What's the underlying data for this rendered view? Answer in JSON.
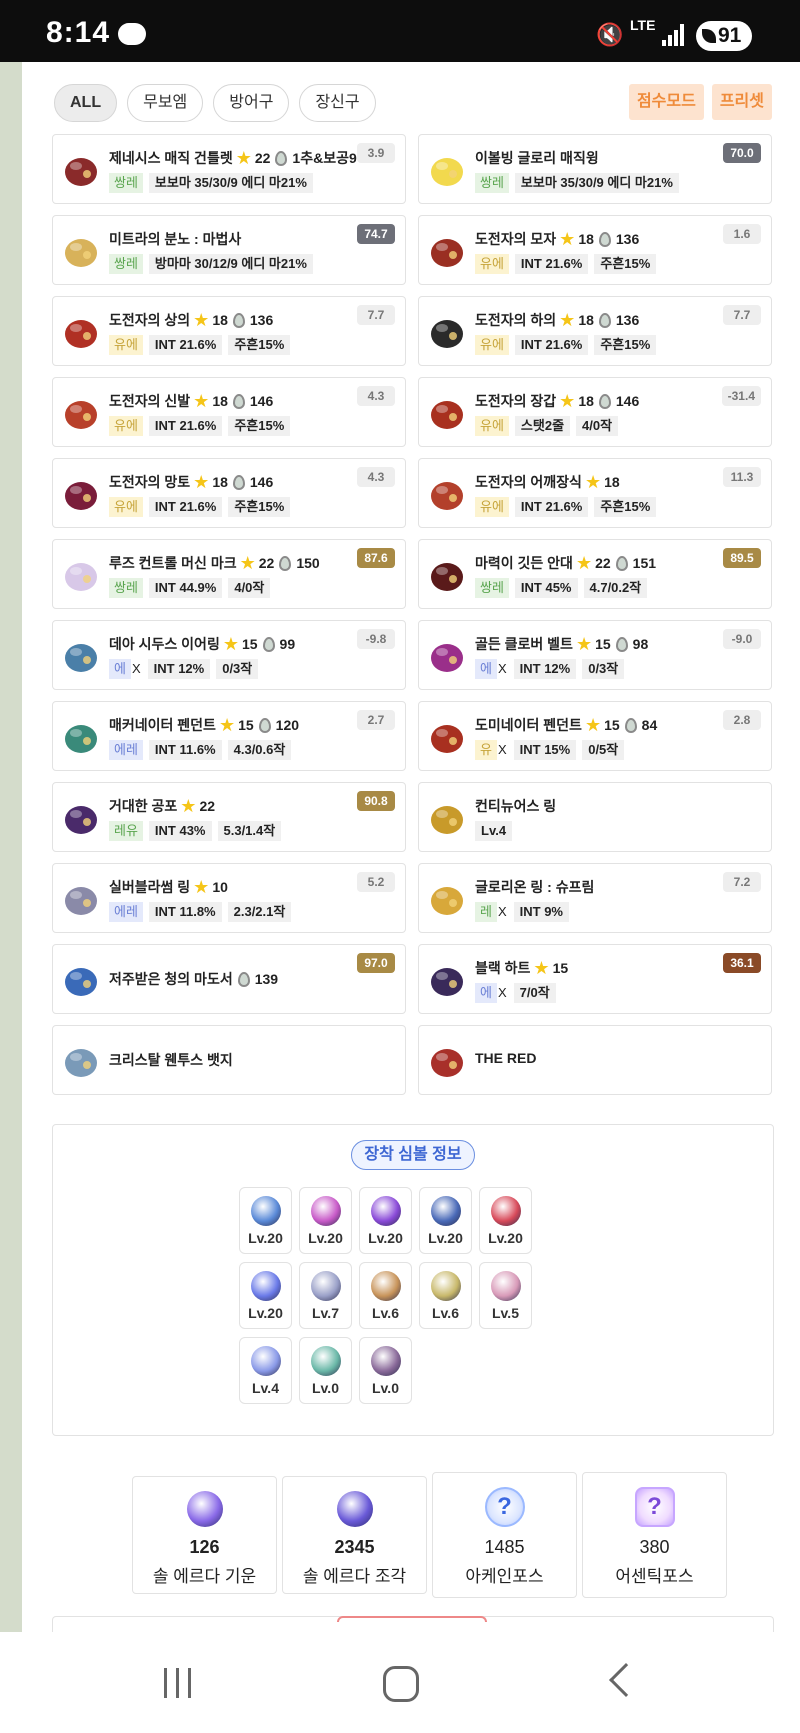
{
  "status_bar": {
    "time": "8:14",
    "network": "LTE",
    "battery": "91"
  },
  "filters": [
    "ALL",
    "무보엠",
    "방어구",
    "장신구"
  ],
  "modes": [
    "점수모드",
    "프리셋"
  ],
  "items": [
    {
      "name": "제네시스 매직 건틀렛",
      "star": "22",
      "drop": "1추&보공9",
      "tags": [
        {
          "t": "쌍레",
          "c": "green"
        },
        {
          "t": "보보마 35/30/9 에디 마21%",
          "c": "plain"
        }
      ],
      "score": "3.9",
      "score_style": "light",
      "icon": "gauntlet-icon",
      "color": "#8a2a2a"
    },
    {
      "name": "이볼빙 글로리 매직윙",
      "tags": [
        {
          "t": "쌍레",
          "c": "green"
        },
        {
          "t": "보보마 35/30/9 에디 마21%",
          "c": "plain"
        }
      ],
      "score": "70.0",
      "score_style": "gray",
      "icon": "wing-icon",
      "color": "#f2d94e"
    },
    {
      "name": "미트라의 분노 : 마법사",
      "tags": [
        {
          "t": "쌍레",
          "c": "green"
        },
        {
          "t": "방마마 30/12/9 에디 마21%",
          "c": "plain"
        }
      ],
      "score": "74.7",
      "score_style": "gray",
      "icon": "emblem-icon",
      "color": "#d8b25a"
    },
    {
      "name": "도전자의 모자",
      "star": "18",
      "drop": "136",
      "tags": [
        {
          "t": "유에",
          "c": "yellow"
        },
        {
          "t": "INT 21.6%",
          "c": "plain"
        },
        {
          "t": "주흔15%",
          "c": "plain"
        }
      ],
      "score": "1.6",
      "score_style": "light",
      "icon": "hat-icon",
      "color": "#9a2f22"
    },
    {
      "name": "도전자의 상의",
      "star": "18",
      "drop": "136",
      "tags": [
        {
          "t": "유에",
          "c": "yellow"
        },
        {
          "t": "INT 21.6%",
          "c": "plain"
        },
        {
          "t": "주흔15%",
          "c": "plain"
        }
      ],
      "score": "7.7",
      "score_style": "light",
      "icon": "top-icon",
      "color": "#b03024"
    },
    {
      "name": "도전자의 하의",
      "star": "18",
      "drop": "136",
      "tags": [
        {
          "t": "유에",
          "c": "yellow"
        },
        {
          "t": "INT 21.6%",
          "c": "plain"
        },
        {
          "t": "주흔15%",
          "c": "plain"
        }
      ],
      "score": "7.7",
      "score_style": "light",
      "icon": "pants-icon",
      "color": "#2a2a2a"
    },
    {
      "name": "도전자의 신발",
      "star": "18",
      "drop": "146",
      "tags": [
        {
          "t": "유에",
          "c": "yellow"
        },
        {
          "t": "INT 21.6%",
          "c": "plain"
        },
        {
          "t": "주흔15%",
          "c": "plain"
        }
      ],
      "score": "4.3",
      "score_style": "light",
      "icon": "shoes-icon",
      "color": "#b8402a"
    },
    {
      "name": "도전자의 장갑",
      "star": "18",
      "drop": "146",
      "tags": [
        {
          "t": "유에",
          "c": "yellow"
        },
        {
          "t": "스탯2줄",
          "c": "plain"
        },
        {
          "t": "4/0작",
          "c": "plain"
        }
      ],
      "score": "-31.4",
      "score_style": "light",
      "icon": "glove-icon",
      "color": "#a8301f"
    },
    {
      "name": "도전자의 망토",
      "star": "18",
      "drop": "146",
      "tags": [
        {
          "t": "유에",
          "c": "yellow"
        },
        {
          "t": "INT 21.6%",
          "c": "plain"
        },
        {
          "t": "주흔15%",
          "c": "plain"
        }
      ],
      "score": "4.3",
      "score_style": "light",
      "icon": "cape-icon",
      "color": "#7a1d3a"
    },
    {
      "name": "도전자의 어깨장식",
      "star": "18",
      "tags": [
        {
          "t": "유에",
          "c": "yellow"
        },
        {
          "t": "INT 21.6%",
          "c": "plain"
        },
        {
          "t": "주흔15%",
          "c": "plain"
        }
      ],
      "score": "11.3",
      "score_style": "light",
      "icon": "shoulder-icon",
      "color": "#b3402b"
    },
    {
      "name": "루즈 컨트롤 머신 마크",
      "star": "22",
      "drop": "150",
      "tags": [
        {
          "t": "쌍레",
          "c": "green"
        },
        {
          "t": "INT 44.9%",
          "c": "plain"
        },
        {
          "t": "4/0작",
          "c": "plain"
        }
      ],
      "score": "87.6",
      "score_style": "gold",
      "icon": "face-accessory-icon",
      "color": "#d8c8e8"
    },
    {
      "name": "마력이 깃든 안대",
      "star": "22",
      "drop": "151",
      "tags": [
        {
          "t": "쌍레",
          "c": "green"
        },
        {
          "t": "INT 45%",
          "c": "plain"
        },
        {
          "t": "4.7/0.2작",
          "c": "plain"
        }
      ],
      "score": "89.5",
      "score_style": "gold",
      "icon": "eye-patch-icon",
      "color": "#5a1a1a"
    },
    {
      "name": "데아 시두스 이어링",
      "star": "15",
      "drop": "99",
      "tags": [
        {
          "t": "에",
          "c": "blue"
        },
        {
          "t": "X",
          "c": "x"
        },
        {
          "t": "INT 12%",
          "c": "plain"
        },
        {
          "t": "0/3작",
          "c": "plain"
        }
      ],
      "score": "-9.8",
      "score_style": "light",
      "icon": "earring-icon",
      "color": "#4a7fa8"
    },
    {
      "name": "골든 클로버 벨트",
      "star": "15",
      "drop": "98",
      "tags": [
        {
          "t": "에",
          "c": "blue"
        },
        {
          "t": "X",
          "c": "x"
        },
        {
          "t": "INT 12%",
          "c": "plain"
        },
        {
          "t": "0/3작",
          "c": "plain"
        }
      ],
      "score": "-9.0",
      "score_style": "light",
      "icon": "belt-icon",
      "color": "#9a2f8a"
    },
    {
      "name": "매커네이터 펜던트",
      "star": "15",
      "drop": "120",
      "tags": [
        {
          "t": "에레",
          "c": "blue"
        },
        {
          "t": "INT 11.6%",
          "c": "plain"
        },
        {
          "t": "4.3/0.6작",
          "c": "plain"
        }
      ],
      "score": "2.7",
      "score_style": "light",
      "icon": "pendant-icon",
      "color": "#3a8a7a"
    },
    {
      "name": "도미네이터 펜던트",
      "star": "15",
      "drop": "84",
      "tags": [
        {
          "t": "유",
          "c": "yellow"
        },
        {
          "t": "X",
          "c": "x"
        },
        {
          "t": "INT 15%",
          "c": "plain"
        },
        {
          "t": "0/5작",
          "c": "plain"
        }
      ],
      "score": "2.8",
      "score_style": "light",
      "icon": "pendant-icon",
      "color": "#a83020"
    },
    {
      "name": "거대한 공포",
      "star": "22",
      "tags": [
        {
          "t": "레유",
          "c": "green"
        },
        {
          "t": "INT 43%",
          "c": "plain"
        },
        {
          "t": "5.3/1.4작",
          "c": "plain"
        }
      ],
      "score": "90.8",
      "score_style": "gold",
      "icon": "pocket-item-icon",
      "color": "#4a2a6a"
    },
    {
      "name": "컨티뉴어스 링",
      "tags": [
        {
          "t": "Lv.4",
          "c": "plain"
        }
      ],
      "score": "",
      "score_style": "none",
      "icon": "ring-icon",
      "color": "#c89a2a"
    },
    {
      "name": "실버블라썸 링",
      "star": "10",
      "tags": [
        {
          "t": "에레",
          "c": "blue"
        },
        {
          "t": "INT 11.8%",
          "c": "plain"
        },
        {
          "t": "2.3/2.1작",
          "c": "plain"
        }
      ],
      "score": "5.2",
      "score_style": "light",
      "icon": "ring-icon",
      "color": "#8a8aa8"
    },
    {
      "name": "글로리온 링 : 슈프림",
      "tags": [
        {
          "t": "레",
          "c": "green"
        },
        {
          "t": "X",
          "c": "x"
        },
        {
          "t": "INT 9%",
          "c": "plain"
        }
      ],
      "score": "7.2",
      "score_style": "light",
      "icon": "ring-icon",
      "color": "#d8a83a"
    },
    {
      "name": "저주받은 청의 마도서",
      "drop": "139",
      "tags": [],
      "score": "97.0",
      "score_style": "gold",
      "icon": "spellbook-icon",
      "color": "#3a6ab8"
    },
    {
      "name": "블랙 하트",
      "star": "15",
      "tags": [
        {
          "t": "에",
          "c": "blue"
        },
        {
          "t": "X",
          "c": "x"
        },
        {
          "t": "7/0작",
          "c": "plain"
        }
      ],
      "score": "36.1",
      "score_style": "brown",
      "icon": "heart-icon",
      "color": "#3a2a5a"
    },
    {
      "name": "크리스탈 웬투스 뱃지",
      "tags": [],
      "score": "",
      "score_style": "none",
      "icon": "badge-icon",
      "color": "#7a9ab8"
    },
    {
      "name": "THE RED",
      "tags": [],
      "score": "",
      "score_style": "none",
      "icon": "medal-icon",
      "color": "#a8302a"
    }
  ],
  "symbols": {
    "title": "장착 심볼 정보",
    "list": [
      {
        "lv": "Lv.20",
        "color": "#5a8ad8"
      },
      {
        "lv": "Lv.20",
        "color": "#c85ac8"
      },
      {
        "lv": "Lv.20",
        "color": "#8a4ad8"
      },
      {
        "lv": "Lv.20",
        "color": "#4a6ab8"
      },
      {
        "lv": "Lv.20",
        "color": "#d84a5a"
      },
      {
        "lv": "Lv.20",
        "color": "#6a7ae8"
      },
      {
        "lv": "Lv.7",
        "color": "#9aa0c8"
      },
      {
        "lv": "Lv.6",
        "color": "#c8945a"
      },
      {
        "lv": "Lv.6",
        "color": "#c8b86a"
      },
      {
        "lv": "Lv.5",
        "color": "#d89ab8"
      },
      {
        "lv": "Lv.4",
        "color": "#8a9ae8"
      },
      {
        "lv": "Lv.0",
        "color": "#6ab8a8"
      },
      {
        "lv": "Lv.0",
        "color": "#8a6a9a"
      }
    ]
  },
  "stats": [
    {
      "num": "126",
      "label": "솔 에르다 기운",
      "color": "#8a6ae8"
    },
    {
      "num": "2345",
      "label": "솔 에르다 조각",
      "color": "#6a5ad8"
    },
    {
      "num": "1485",
      "label": "아케인포스",
      "color": "#9bb9ff"
    },
    {
      "num": "380",
      "label": "어센틱포스",
      "color": "#c7a6ff"
    }
  ]
}
